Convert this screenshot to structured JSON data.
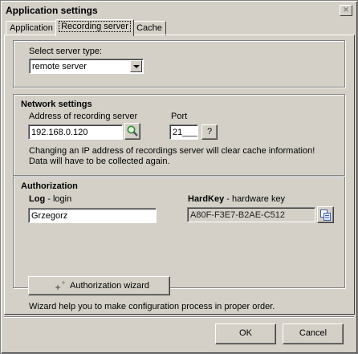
{
  "window": {
    "title": "Application settings",
    "close_label": "✕"
  },
  "tabs": [
    {
      "label": "Application"
    },
    {
      "label": "Recording server"
    },
    {
      "label": "Cache"
    }
  ],
  "server_type": {
    "label": "Select server type:",
    "value": "remote server"
  },
  "network": {
    "heading": "Network settings",
    "address_label": "Address of recording server",
    "address_value": "192.168.0.120",
    "port_label": "Port",
    "port_value": "21___",
    "help_label": "?",
    "warning_line1": "Changing an IP address of recordings server will clear cache information!",
    "warning_line2": "Data will have to be collected again."
  },
  "authorization": {
    "heading": "Authorization",
    "log_label_bold": "Log",
    "log_label_rest": " - login",
    "log_value": "Grzegorz",
    "hardkey_label_bold": "HardKey",
    "hardkey_label_rest": " - hardware key",
    "hardkey_value": "A80F-F3E7-B2AE-C512",
    "wizard_button": "Authorization wizard",
    "wizard_hint": "Wizard help you to make configuration process in proper order."
  },
  "footer": {
    "ok_label": "OK",
    "cancel_label": "Cancel"
  },
  "icons": {
    "search": "magnifier-icon",
    "copy": "copy-icon",
    "wizard": "sparkle-icon"
  },
  "colors": {
    "face": "#d4d0c8",
    "shadow": "#808080",
    "highlight": "#ffffff"
  }
}
